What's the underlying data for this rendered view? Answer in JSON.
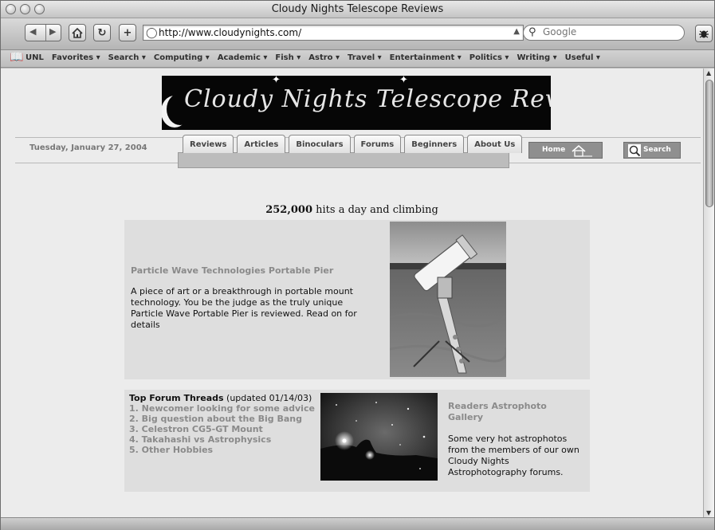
{
  "window": {
    "title": "Cloudy Nights Telescope Reviews"
  },
  "toolbar": {
    "back_icon": "back-arrow-icon",
    "forward_icon": "forward-arrow-icon",
    "home_icon": "home-icon",
    "reload_icon": "reload-icon",
    "add_bookmark_label": "+",
    "address_url": "http://www.cloudynights.com/",
    "search_placeholder": "Google"
  },
  "bookmarks_bar": {
    "items": [
      {
        "label": "UNL"
      },
      {
        "label": "Favorites ▾"
      },
      {
        "label": "Search ▾"
      },
      {
        "label": "Computing ▾"
      },
      {
        "label": "Academic ▾"
      },
      {
        "label": "Fish ▾"
      },
      {
        "label": "Astro ▾"
      },
      {
        "label": "Travel ▾"
      },
      {
        "label": "Entertainment ▾"
      },
      {
        "label": "Politics ▾"
      },
      {
        "label": "Writing ▾"
      },
      {
        "label": "Useful ▾"
      }
    ]
  },
  "site": {
    "banner_text": "Cloudy Nights Telescope Reviews",
    "date": "Tuesday, January 27, 2004",
    "tabs": [
      {
        "label": "Reviews"
      },
      {
        "label": "Articles"
      },
      {
        "label": "Binoculars"
      },
      {
        "label": "Forums"
      },
      {
        "label": "Beginners"
      },
      {
        "label": "About Us"
      }
    ],
    "home_button": "Home",
    "search_button": "Search"
  },
  "hits": {
    "count": "252,000",
    "suffix": "hits a day and climbing"
  },
  "feature": {
    "title": "Particle Wave Technologies Portable Pier",
    "body": "A piece of art or a breakthrough in portable mount technology. You be the judge as the truly unique Particle Wave Portable Pier is reviewed. Read on for details"
  },
  "forum": {
    "heading": "Top Forum Threads",
    "updated": " (updated 01/14/03)",
    "threads": [
      {
        "label": "1. Newcomer looking for some advice"
      },
      {
        "label": "2. Big question about the Big Bang"
      },
      {
        "label": "3. Celestron CG5-GT Mount"
      },
      {
        "label": "4. Takahashi vs Astrophysics"
      },
      {
        "label": "5. Other Hobbies"
      }
    ]
  },
  "gallery": {
    "title": "Readers Astrophoto Gallery",
    "body": "Some very hot astrophotos from the members of our own Cloudy Nights Astrophotography forums."
  }
}
